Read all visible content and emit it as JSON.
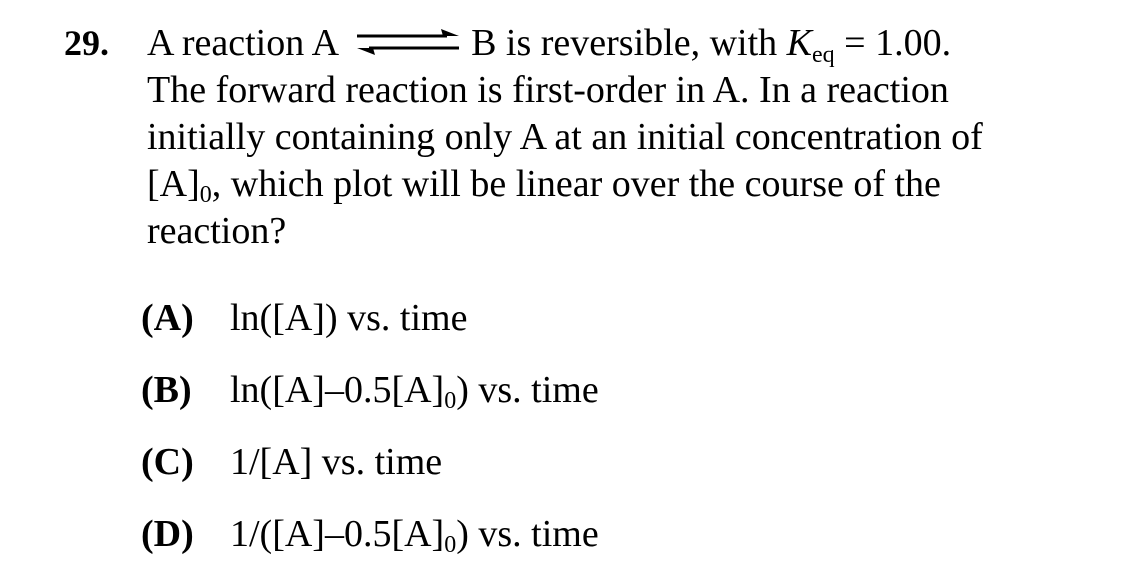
{
  "question": {
    "number": "29.",
    "stem": {
      "part1": "A reaction A",
      "part2": "B is reversible, with",
      "k_symbol": "K",
      "k_subscript": "eq",
      "k_value": "= 1.00.",
      "line2": "The forward reaction is first-order in A.  In a reaction",
      "line3": "initially containing only A at an initial concentration of",
      "line4_a": "[A]",
      "line4_sub": "0",
      "line4_b": ", which plot will be linear over the course of the",
      "line5": "reaction?"
    },
    "choices": [
      {
        "label": "(A)",
        "text_a": "ln([A]) vs. time",
        "sub": "",
        "text_b": ""
      },
      {
        "label": "(B)",
        "text_a": "ln([A]–0.5[A]",
        "sub": "0",
        "text_b": ") vs. time"
      },
      {
        "label": "(C)",
        "text_a": "1/[A] vs. time",
        "sub": "",
        "text_b": ""
      },
      {
        "label": "(D)",
        "text_a": "1/([A]–0.5[A]",
        "sub": "0",
        "text_b": ") vs. time"
      }
    ]
  }
}
